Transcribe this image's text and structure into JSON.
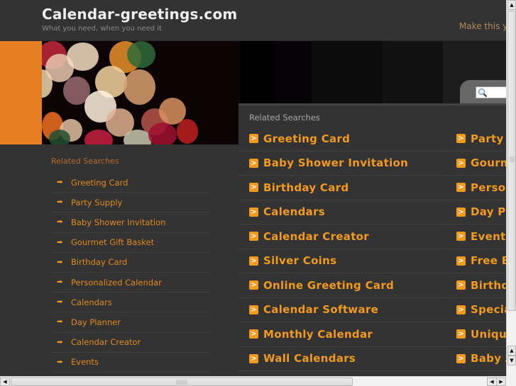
{
  "header": {
    "site_title": "Calendar-greetings.com",
    "tagline": "What you need, when you need it",
    "promo_text": "Make this yo"
  },
  "search": {
    "icon": "search-icon",
    "placeholder": ""
  },
  "colors": {
    "accent_orange": "#e67e22",
    "link_orange": "#f29a1e",
    "background": "#333333"
  },
  "sidebar": {
    "title": "Related Searches",
    "items": [
      {
        "label": "Greeting Card"
      },
      {
        "label": "Party Supply"
      },
      {
        "label": "Baby Shower Invitation"
      },
      {
        "label": "Gourmet Gift Basket"
      },
      {
        "label": "Birthday Card"
      },
      {
        "label": "Personalized Calendar"
      },
      {
        "label": "Calendars"
      },
      {
        "label": "Day Planner"
      },
      {
        "label": "Calendar Creator"
      },
      {
        "label": "Events"
      }
    ]
  },
  "main": {
    "title": "Related Searches",
    "column_1": [
      {
        "label": "Greeting Card"
      },
      {
        "label": "Baby Shower Invitation"
      },
      {
        "label": "Birthday Card"
      },
      {
        "label": "Calendars"
      },
      {
        "label": "Calendar Creator"
      },
      {
        "label": "Silver Coins"
      },
      {
        "label": "Online Greeting Card"
      },
      {
        "label": "Calendar Software"
      },
      {
        "label": "Monthly Calendar"
      },
      {
        "label": "Wall Calendars"
      }
    ],
    "column_2": [
      {
        "label": "Party"
      },
      {
        "label": "Gourm"
      },
      {
        "label": "Perso"
      },
      {
        "label": "Day Pl"
      },
      {
        "label": "Events"
      },
      {
        "label": "Free E"
      },
      {
        "label": "Birthd"
      },
      {
        "label": "Specia"
      },
      {
        "label": "Unique"
      },
      {
        "label": "Baby A"
      }
    ]
  },
  "scrollbars": {
    "vertical_position": 0,
    "horizontal_position": 0
  }
}
